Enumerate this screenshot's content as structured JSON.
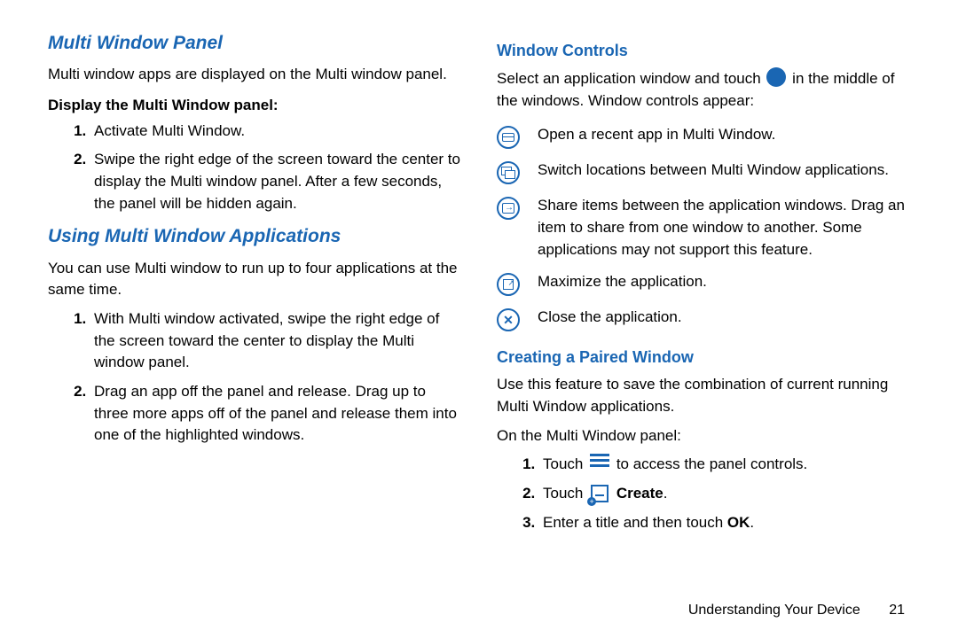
{
  "left": {
    "section1_heading": "Multi Window Panel",
    "section1_intro": "Multi window apps are displayed on the Multi window panel.",
    "section1_sub": "Display the Multi Window panel:",
    "section1_steps": [
      "Activate Multi Window.",
      "Swipe the right edge of the screen toward the center to display the Multi window panel. After a few seconds, the panel will be hidden again."
    ],
    "section2_heading": "Using Multi Window Applications",
    "section2_intro": "You can use Multi window to run up to four applications at the same time.",
    "section2_steps": [
      "With Multi window activated, swipe the right edge of the screen toward the center to display the Multi window panel.",
      "Drag an app off the panel and release. Drag up to three more apps off of the panel and release them into one of the highlighted windows."
    ]
  },
  "right": {
    "wc_heading": "Window Controls",
    "wc_intro_pre": "Select an application window and touch ",
    "wc_intro_post": " in the middle of the windows. Window controls appear:",
    "wc_items": [
      "Open a recent app in Multi Window.",
      "Switch locations between Multi Window applications.",
      "Share items between the application windows. Drag an item to share from one window to another. Some applications may not support this feature.",
      "Maximize the application.",
      "Close the application."
    ],
    "pw_heading": "Creating a Paired Window",
    "pw_intro": "Use this feature to save the combination of current running Multi Window applications.",
    "pw_intro2": "On the Multi Window panel:",
    "pw_step1_pre": "Touch ",
    "pw_step1_post": " to access the panel controls.",
    "pw_step2_pre": "Touch ",
    "pw_step2_label": "Create",
    "pw_step2_post": ".",
    "pw_step3_pre": "Enter a title and then touch ",
    "pw_step3_bold": "OK",
    "pw_step3_post": "."
  },
  "footer": {
    "section_title": "Understanding Your Device",
    "page_number": "21"
  }
}
